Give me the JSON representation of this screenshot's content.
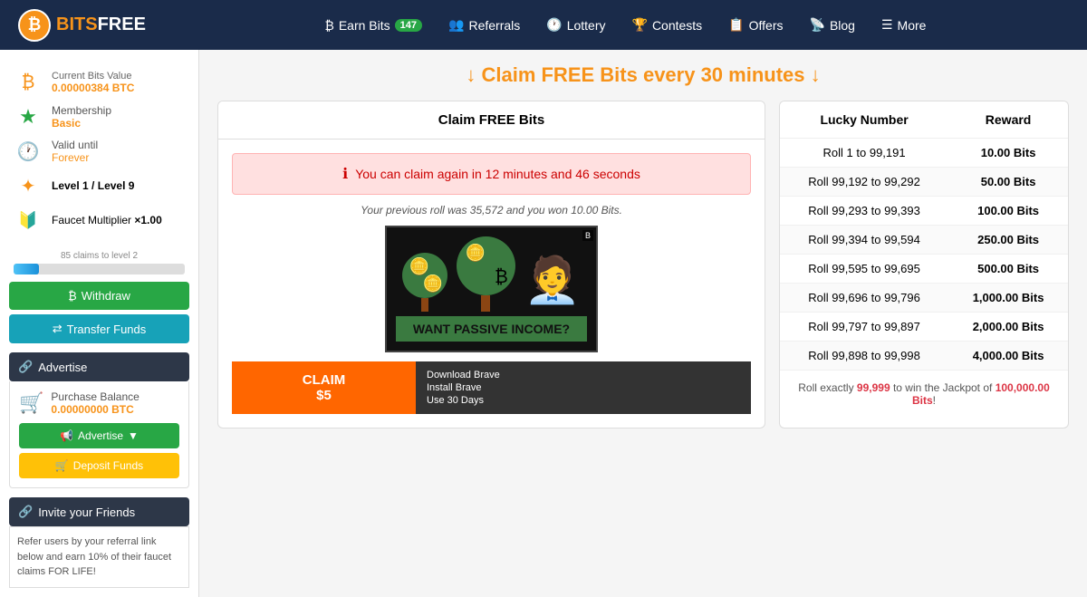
{
  "header": {
    "logo_letter": "₿",
    "logo_bits": "BITS",
    "logo_free": "FREE",
    "nav": [
      {
        "icon": "₿",
        "label": "Earn Bits",
        "badge": "147"
      },
      {
        "icon": "👥",
        "label": "Referrals",
        "badge": null
      },
      {
        "icon": "🕐",
        "label": "Lottery",
        "badge": null
      },
      {
        "icon": "🏆",
        "label": "Contests",
        "badge": null
      },
      {
        "icon": "📋",
        "label": "Offers",
        "badge": null
      },
      {
        "icon": "📡",
        "label": "Blog",
        "badge": null
      },
      {
        "icon": "☰",
        "label": "More",
        "badge": null
      }
    ]
  },
  "sidebar": {
    "bits_label": "Current Bits Value",
    "bits_value": "0.00000384 BTC",
    "membership_label": "Membership",
    "membership_value": "Basic",
    "valid_label": "Valid until",
    "valid_value": "Forever",
    "level_label": "Level",
    "level_value": "1",
    "level_max": "Level 9",
    "faucet_label": "Faucet Multiplier",
    "faucet_value": "×1.00",
    "progress_label": "85 claims to level 2",
    "progress_pct": 15,
    "withdraw_label": "Withdraw",
    "transfer_label": "Transfer Funds",
    "advertise_section": "Advertise",
    "purchase_label": "Purchase Balance",
    "purchase_value": "0.00000000 BTC",
    "advertise_btn": "Advertise",
    "deposit_btn": "Deposit Funds",
    "invite_section": "Invite your Friends",
    "invite_text": "Refer users by your referral link below and earn 10% of their faucet claims FOR LIFE!"
  },
  "main": {
    "claim_header": "↓ Claim FREE Bits every 30 minutes ↓",
    "claim_card_title": "Claim FREE Bits",
    "alert_text": "You can claim again in 12 minutes and 46 seconds",
    "prev_roll_text": "Your previous roll was 35,572 and you won 10.00 Bits.",
    "ad_title": "WANT PASSIVE INCOME?",
    "cta_claim": "CLAIM\n$5",
    "cta_line1": "Download Brave",
    "cta_line2": "Install Brave",
    "cta_line3": "Use 30 Days"
  },
  "lucky_table": {
    "col1": "Lucky Number",
    "col2": "Reward",
    "rows": [
      {
        "range": "Roll 1 to 99,191",
        "reward": "10.00 Bits"
      },
      {
        "range": "Roll 99,192 to 99,292",
        "reward": "50.00 Bits"
      },
      {
        "range": "Roll 99,293 to 99,393",
        "reward": "100.00 Bits"
      },
      {
        "range": "Roll 99,394 to 99,594",
        "reward": "250.00 Bits"
      },
      {
        "range": "Roll 99,595 to 99,695",
        "reward": "500.00 Bits"
      },
      {
        "range": "Roll 99,696 to 99,796",
        "reward": "1,000.00 Bits"
      },
      {
        "range": "Roll 99,797 to 99,897",
        "reward": "2,000.00 Bits"
      },
      {
        "range": "Roll 99,898 to 99,998",
        "reward": "4,000.00 Bits"
      }
    ],
    "jackpot_text": "Roll exactly 99,999 to win the Jackpot of 100,000.00 Bits!"
  }
}
